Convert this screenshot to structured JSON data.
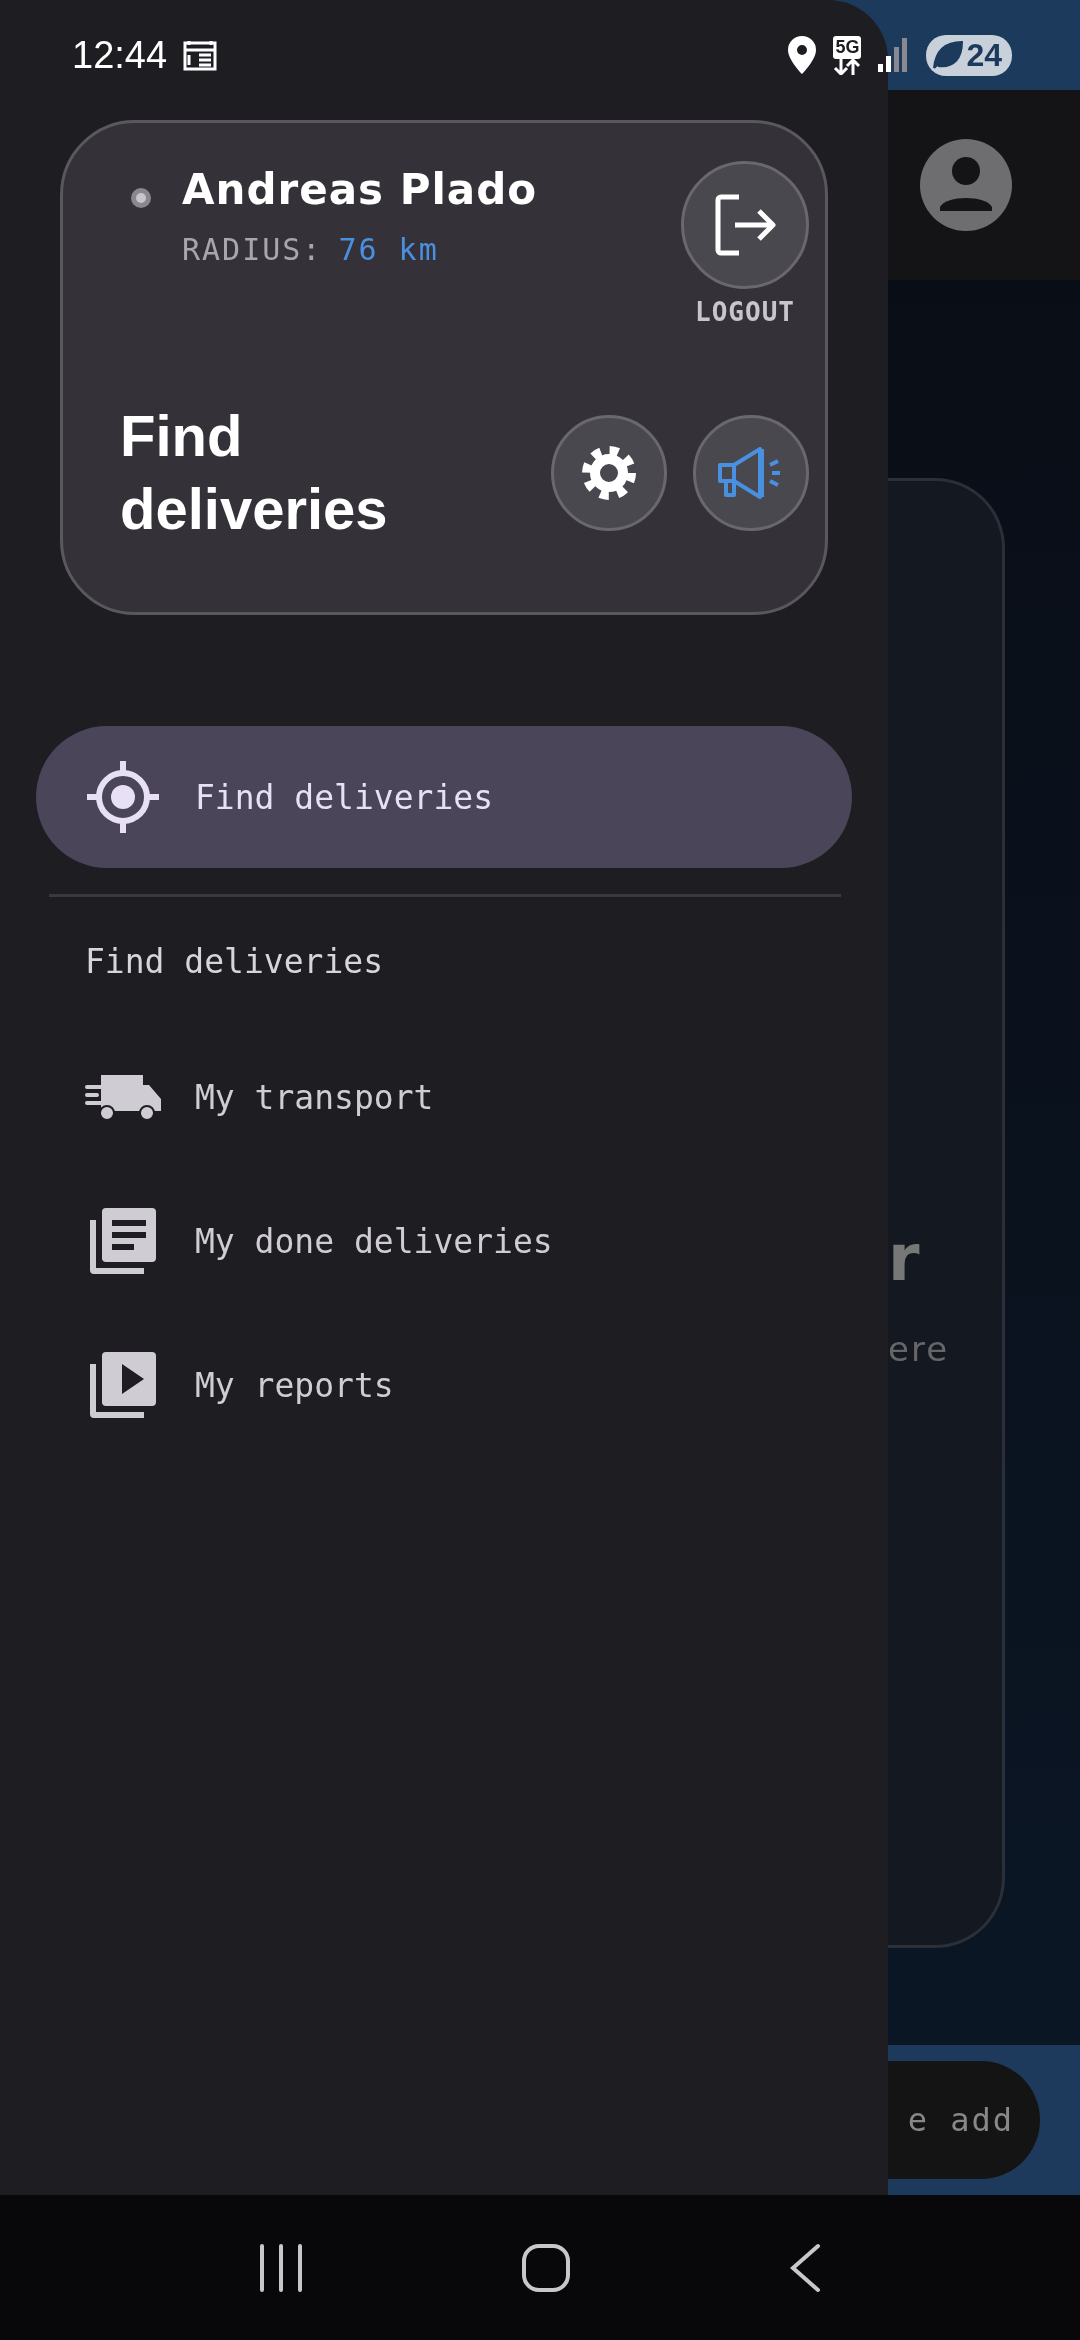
{
  "status_bar": {
    "time": "12:44",
    "network": "5G",
    "battery": "24"
  },
  "drawer": {
    "user": {
      "name": "Andreas Plado",
      "radius_label": "RADIUS:",
      "radius_value": "76 km"
    },
    "logout_label": "LOGOUT",
    "title": "Find deliveries",
    "menu": [
      {
        "label": "Find deliveries",
        "selected": true
      }
    ],
    "section": {
      "title": "Find deliveries",
      "items": [
        {
          "label": "My transport",
          "selected": false
        },
        {
          "label": "My done deliveries",
          "selected": false
        },
        {
          "label": "My reports",
          "selected": false
        }
      ]
    }
  },
  "backdrop": {
    "card_heading": "r",
    "card_text": "ere",
    "add_button": "e add"
  }
}
